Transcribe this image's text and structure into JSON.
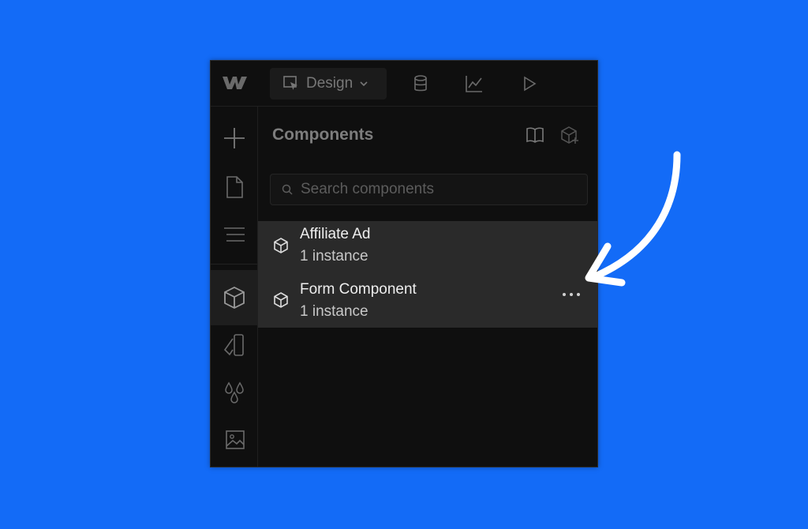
{
  "app": {
    "mode_label": "Design",
    "mode_icon": "cursor-select-icon",
    "top_icons": [
      "database-icon",
      "analytics-chart-icon",
      "play-icon"
    ]
  },
  "sidebar": {
    "icons": [
      "plus-icon",
      "page-icon",
      "navigator-icon",
      "components-icon",
      "style-manager-icon",
      "variables-icon",
      "assets-icon"
    ],
    "active": "components-icon"
  },
  "panel": {
    "title": "Components",
    "header_icons": [
      "book-icon",
      "add-component-icon"
    ],
    "search": {
      "placeholder": "Search components",
      "value": ""
    }
  },
  "components": [
    {
      "name": "Affiliate Ad",
      "instances": "1 instance"
    },
    {
      "name": "Form Component",
      "instances": "1 instance"
    }
  ],
  "colors": {
    "background": "#136bf7",
    "panel": "#0f0f0f",
    "list_highlight": "#2a2a2a",
    "annotation_arrow": "#ffffff"
  }
}
